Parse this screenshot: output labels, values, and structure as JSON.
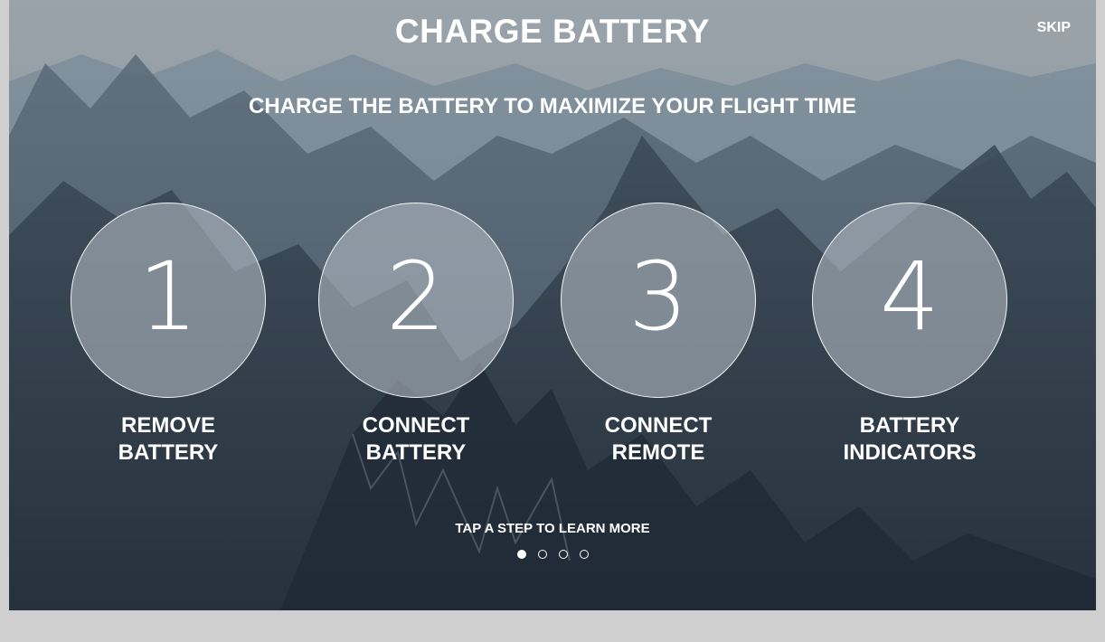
{
  "header": {
    "title": "CHARGE BATTERY",
    "skip_label": "SKIP"
  },
  "subtitle": "CHARGE THE BATTERY TO MAXIMIZE YOUR FLIGHT TIME",
  "steps": [
    {
      "number": "1",
      "label_line1": "REMOVE",
      "label_line2": "BATTERY"
    },
    {
      "number": "2",
      "label_line1": "CONNECT",
      "label_line2": "BATTERY"
    },
    {
      "number": "3",
      "label_line1": "CONNECT",
      "label_line2": "REMOTE"
    },
    {
      "number": "4",
      "label_line1": "BATTERY",
      "label_line2": "INDICATORS"
    }
  ],
  "hint": "TAP A STEP TO LEARN MORE",
  "pagination": {
    "total": 4,
    "active_index": 0
  },
  "colors": {
    "text": "#ffffff",
    "circle_fill": "rgba(175,182,192,0.62)",
    "outer_background": "#cfcfcf"
  }
}
